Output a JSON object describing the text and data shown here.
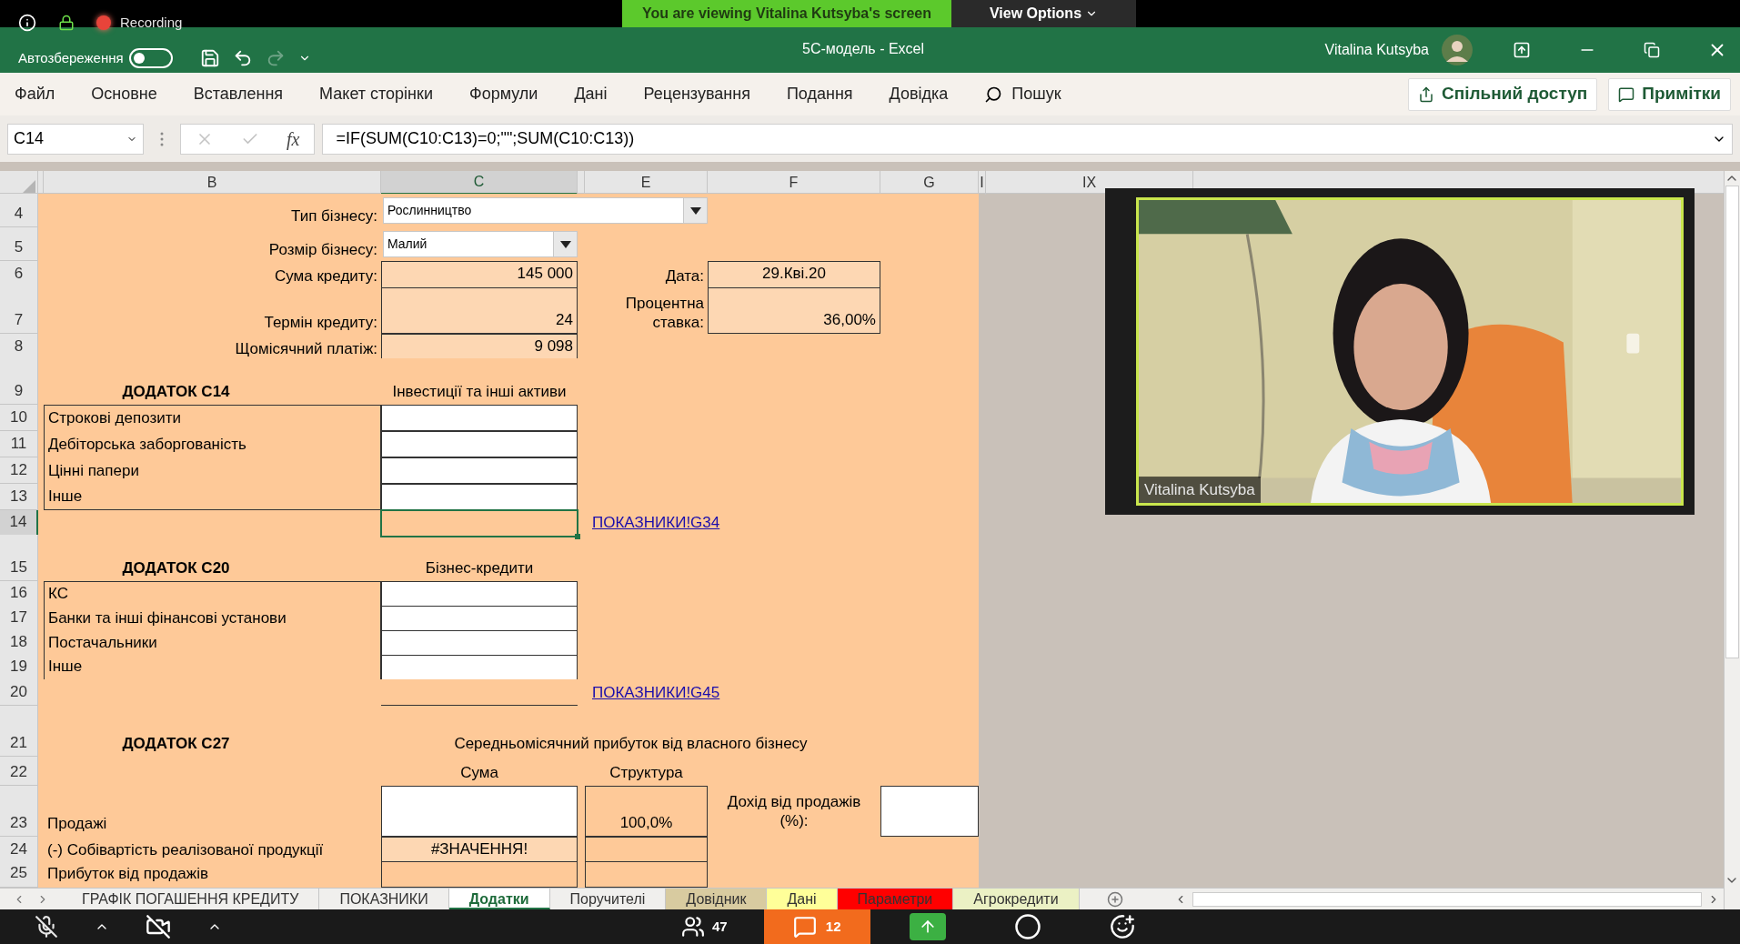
{
  "zoom_banner": {
    "text": "You are viewing Vitalina Kutsyba's screen",
    "view_options": "View Options"
  },
  "recording": {
    "label": "Recording"
  },
  "title_bar": {
    "autosave_label": "Автозбереження",
    "autosave_on": false,
    "title": "5C-модель - Excel",
    "user": "Vitalina Kutsyba"
  },
  "quick_access": [
    {
      "kind": "save",
      "disabled": false
    },
    {
      "kind": "undo",
      "disabled": false
    },
    {
      "kind": "redo",
      "disabled": true
    },
    {
      "kind": "customize",
      "disabled": false
    }
  ],
  "ribbon_tabs": [
    "Файл",
    "Основне",
    "Вставлення",
    "Макет сторінки",
    "Формули",
    "Дані",
    "Рецензування",
    "Подання",
    "Довідка"
  ],
  "search": {
    "label": "Пошук"
  },
  "share_button": "Спільний доступ",
  "comments_button": "Примітки",
  "formula_bar": {
    "name_box": "C14",
    "fx_label": "fx",
    "formula": "=IF(SUM(C10:C13)=0;\"\";SUM(C10:C13))",
    "edit_buttons_disabled": true
  },
  "column_headers": {
    "B": {
      "label": "B",
      "selected": false
    },
    "C": {
      "label": "C",
      "selected": true
    },
    "E": {
      "label": "E",
      "selected": false
    },
    "F": {
      "label": "F",
      "selected": false
    },
    "G": {
      "label": "G",
      "selected": false
    },
    "I": {
      "label": "I",
      "selected": false
    },
    "IX": {
      "label": "IX",
      "selected": false
    }
  },
  "rows": [
    {
      "number": "4",
      "cells": {
        "B": {
          "kind": "label",
          "text": "Тип бізнесу:",
          "selected": false
        },
        "C:E": {
          "kind": "dropdown",
          "text": "Рослинництво",
          "selected": false
        }
      }
    },
    {
      "number": "5",
      "cells": {
        "B": {
          "kind": "label",
          "text": "Розмір бізнесу:",
          "selected": false
        },
        "C": {
          "kind": "dropdown",
          "text": "Малий",
          "selected": false
        }
      }
    },
    {
      "number": "6",
      "cells": {
        "B": {
          "kind": "label",
          "text": "Сума кредиту:",
          "selected": false
        },
        "C": {
          "kind": "value",
          "text": "145 000",
          "selected": false
        },
        "E": {
          "kind": "label",
          "text": "Дата:",
          "selected": false
        },
        "F": {
          "kind": "date",
          "text": "29.Кві.20",
          "selected": false
        }
      }
    },
    {
      "number": "7",
      "cells": {
        "B": {
          "kind": "label",
          "text": "Термін кредиту:",
          "selected": false
        },
        "C": {
          "kind": "value",
          "text": "24",
          "selected": false
        },
        "E": {
          "kind": "label",
          "text": "Процентна ставка:",
          "selected": false
        },
        "F": {
          "kind": "value",
          "text": "36,00%",
          "selected": false
        }
      }
    },
    {
      "number": "8",
      "cells": {
        "B": {
          "kind": "label",
          "text": "Щомісячний платіж:",
          "selected": false
        },
        "C": {
          "kind": "value",
          "text": "9 098",
          "selected": false
        }
      }
    },
    {
      "number": "9",
      "cells": {
        "B": {
          "kind": "heading",
          "text": "ДОДАТОК С14",
          "selected": false
        },
        "C": {
          "kind": "caption",
          "text": "Інвестиції та інші активи",
          "selected": false
        }
      }
    },
    {
      "number": "10",
      "cells": {
        "B": {
          "kind": "item",
          "text": "Строкові депозити",
          "selected": false
        },
        "C": {
          "kind": "input",
          "selected": false
        }
      }
    },
    {
      "number": "11",
      "cells": {
        "B": {
          "kind": "item",
          "text": "Дебіторська заборгованість",
          "selected": false
        },
        "C": {
          "kind": "input",
          "selected": false
        }
      }
    },
    {
      "number": "12",
      "cells": {
        "B": {
          "kind": "item",
          "text": "Цінні папери",
          "selected": false
        },
        "C": {
          "kind": "input",
          "selected": false
        }
      }
    },
    {
      "number": "13",
      "cells": {
        "B": {
          "kind": "item",
          "text": "Інше",
          "selected": false
        },
        "C": {
          "kind": "input",
          "selected": false
        }
      }
    },
    {
      "number": "14",
      "cells": {
        "C": {
          "kind": "empty",
          "selected": true
        },
        "E": {
          "kind": "link",
          "text": "ПОКАЗНИКИ!G34",
          "selected": false
        }
      }
    },
    {
      "number": "15",
      "cells": {
        "B": {
          "kind": "heading",
          "text": "ДОДАТОК С20",
          "selected": false
        },
        "C": {
          "kind": "caption",
          "text": "Бізнес-кредити",
          "selected": false
        }
      }
    },
    {
      "number": "16",
      "cells": {
        "B": {
          "kind": "item",
          "text": "КС",
          "selected": false
        },
        "C": {
          "kind": "input",
          "selected": false
        }
      }
    },
    {
      "number": "17",
      "cells": {
        "B": {
          "kind": "item",
          "text": "Банки та інші фінансові установи",
          "selected": false
        },
        "C": {
          "kind": "input",
          "selected": false
        }
      }
    },
    {
      "number": "18",
      "cells": {
        "B": {
          "kind": "item",
          "text": "Постачальники",
          "selected": false
        },
        "C": {
          "kind": "input",
          "selected": false
        }
      }
    },
    {
      "number": "19",
      "cells": {
        "B": {
          "kind": "item",
          "text": "Інше",
          "selected": false
        },
        "C": {
          "kind": "input",
          "selected": false
        }
      }
    },
    {
      "number": "20",
      "cells": {
        "C": {
          "kind": "total",
          "selected": false
        },
        "E": {
          "kind": "link",
          "text": "ПОКАЗНИКИ!G45",
          "selected": false
        }
      }
    },
    {
      "number": "21",
      "cells": {
        "B": {
          "kind": "heading",
          "text": "ДОДАТОК С27",
          "selected": false
        },
        "C:F": {
          "kind": "caption",
          "text": "Середньомісячний прибуток від власного бізнесу",
          "selected": false
        }
      }
    },
    {
      "number": "22",
      "cells": {
        "C": {
          "kind": "caption",
          "text": "Сума",
          "selected": false
        },
        "E": {
          "kind": "caption",
          "text": "Структура",
          "selected": false
        }
      }
    },
    {
      "number": "23",
      "cells": {
        "B": {
          "kind": "text",
          "text": "Продажі",
          "selected": false
        },
        "C": {
          "kind": "input",
          "selected": false
        },
        "E": {
          "kind": "box",
          "text": "100,0%",
          "selected": false
        },
        "F": {
          "kind": "note",
          "text": "Дохід від продажів (%):",
          "selected": false
        },
        "G": {
          "kind": "input",
          "selected": false
        }
      }
    },
    {
      "number": "24",
      "cells": {
        "B": {
          "kind": "text",
          "text": "(-) Собівартість реалізованої продукції",
          "selected": false
        },
        "C": {
          "kind": "error",
          "text": "#ЗНАЧЕННЯ!",
          "selected": false
        },
        "E": {
          "kind": "box",
          "selected": false
        }
      }
    },
    {
      "number": "25",
      "cells": {
        "B": {
          "kind": "text",
          "text": "Прибуток від продажів",
          "selected": false
        },
        "C": {
          "kind": "box",
          "selected": false
        },
        "E": {
          "kind": "box",
          "selected": false
        }
      }
    }
  ],
  "sheet_tabs": [
    {
      "label": "ГРАФІК ПОГАШЕННЯ КРЕДИТУ",
      "selected": false
    },
    {
      "label": "ПОКАЗНИКИ",
      "selected": false
    },
    {
      "label": "Додатки",
      "selected": true
    },
    {
      "label": "Поручителі",
      "selected": false
    },
    {
      "label": "Довідник",
      "selected": false,
      "color": "#d8cba0"
    },
    {
      "label": "Дані",
      "selected": false,
      "color": "#ffff99"
    },
    {
      "label": "Параметри",
      "selected": false,
      "color": "#ff0000"
    },
    {
      "label": "Агрокредити",
      "selected": false,
      "color": "#ebf1c4"
    }
  ],
  "video": {
    "name": "Vitalina Kutsyba"
  },
  "meeting_controls": {
    "participants": "47",
    "chat": "12"
  }
}
